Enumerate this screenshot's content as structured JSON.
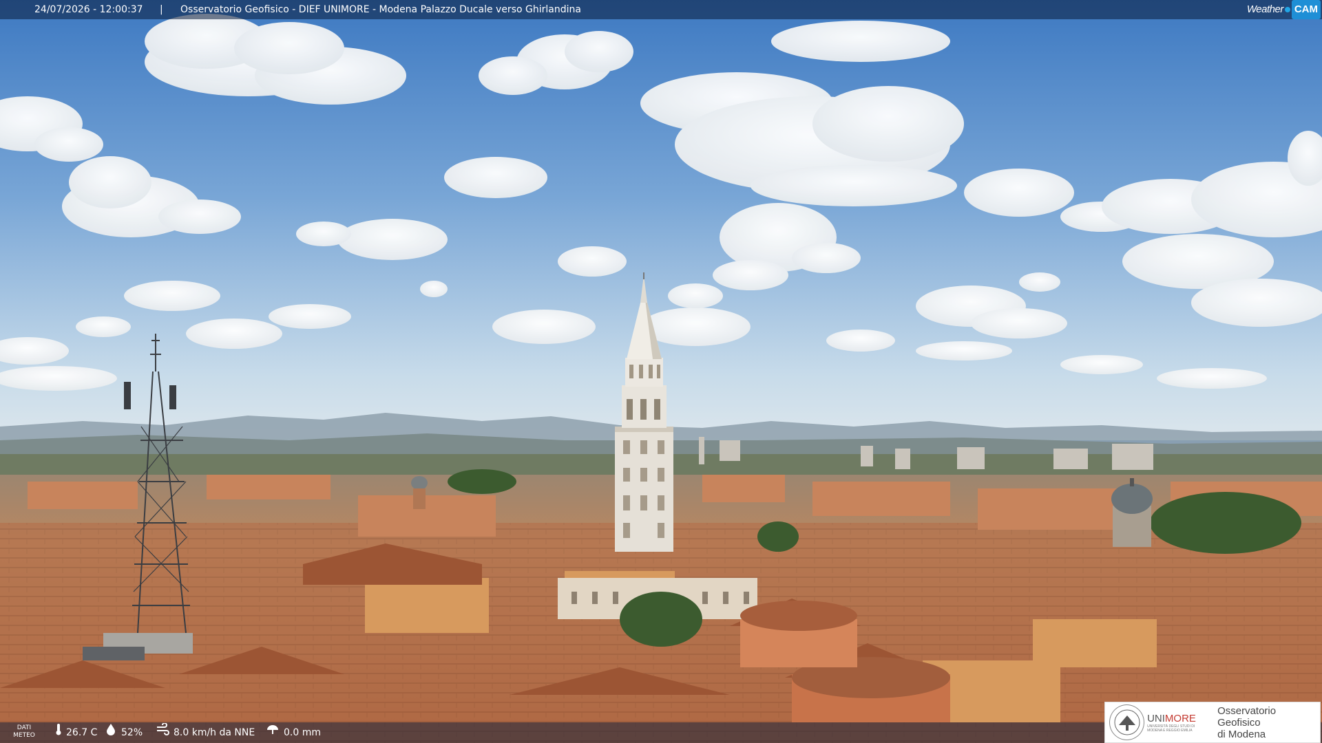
{
  "header": {
    "timestamp": "24/07/2026 - 12:00:37",
    "separator": "|",
    "title": "Osservatorio Geofisico - DIEF UNIMORE - Modena Palazzo Ducale verso Ghirlandina",
    "brand_weather": "Weather",
    "brand_cam": "CAM"
  },
  "weather": {
    "label": "DATI METEO",
    "temperature": "26.7 C",
    "humidity": "52%",
    "wind": "8.0 km/h da NNE",
    "rain": "0.0 mm",
    "icons": [
      "thermometer-icon",
      "humidity-icon",
      "wind-icon",
      "rain-icon"
    ]
  },
  "logo": {
    "university_prefix": "UNI",
    "university_suffix": "MORE",
    "university_sub": "UNIVERSITÀ DEGLI STUDI DI MODENA E REGGIO EMILIA",
    "observatory_line1": "Osservatorio Geofisico",
    "observatory_line2": "di Modena"
  },
  "colors": {
    "sky_top": "#4f86c8",
    "sky_horizon": "#cfe0ee",
    "roofs": "#b97350",
    "tower": "#e6e1d8",
    "brand_blue": "#1f8fd6",
    "unimore_red": "#c43b32"
  }
}
